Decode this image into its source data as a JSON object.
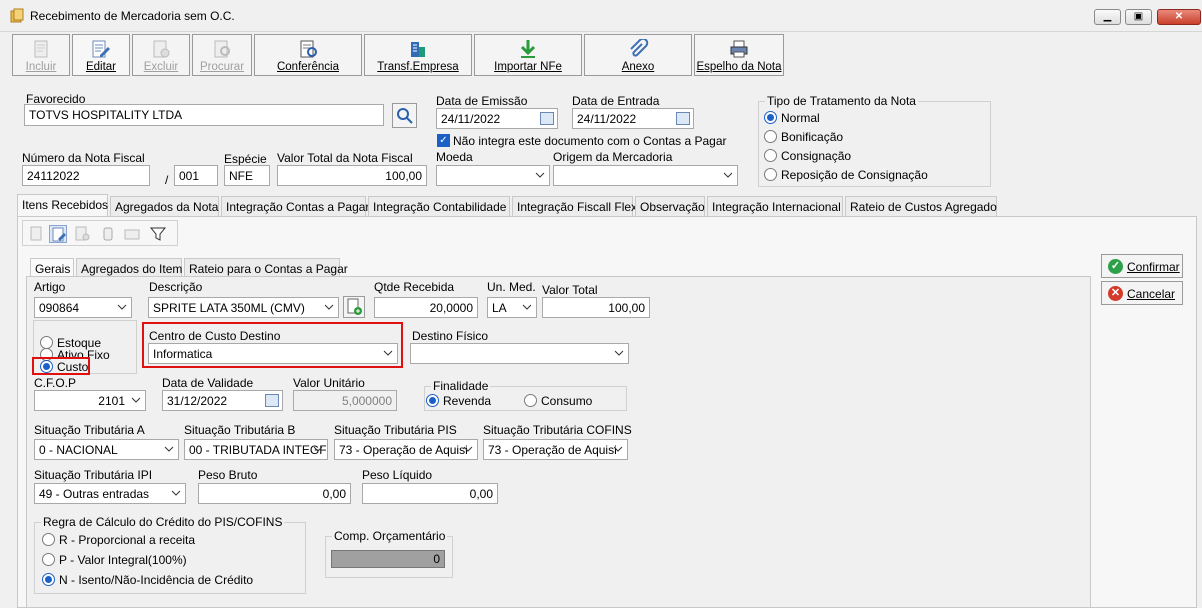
{
  "window": {
    "title": "Recebimento de Mercadoria sem O.C."
  },
  "toolbar": [
    {
      "label": "Incluir",
      "enabled": false
    },
    {
      "label": "Editar",
      "enabled": true
    },
    {
      "label": "Excluir",
      "enabled": false
    },
    {
      "label": "Procurar",
      "enabled": false
    },
    {
      "label": "Conferência",
      "enabled": true
    },
    {
      "label": "Transf.Empresa",
      "enabled": true
    },
    {
      "label": "Importar NFe",
      "enabled": true
    },
    {
      "label": "Anexo",
      "enabled": true
    },
    {
      "label": "Espelho da Nota",
      "enabled": true
    }
  ],
  "header": {
    "favorecido_group": "Favorecido",
    "favorecido_value": "TOTVS HOSPITALITY LTDA",
    "data_emissao_label": "Data de Emissão",
    "data_emissao": "24/11/2022",
    "data_entrada_label": "Data de Entrada",
    "data_entrada": "24/11/2022",
    "nao_integra_label": "Não integra este documento com o Contas a Pagar",
    "nao_integra_checked": true,
    "tipo_tratamento_group": "Tipo de Tratamento da Nota",
    "tipo_tratamento_options": [
      "Normal",
      "Bonificação",
      "Consignação",
      "Reposição de Consignação"
    ],
    "tipo_tratamento_selected": "Normal",
    "numero_nf_label": "Número da Nota Fiscal",
    "numero_nf": "24112022",
    "serie_sep": "/",
    "serie": "001",
    "especie_label": "Espécie",
    "especie": "NFE",
    "valor_total_label": "Valor Total da Nota Fiscal",
    "valor_total": "100,00",
    "moeda_label": "Moeda",
    "moeda": "",
    "origem_label": "Origem da Mercadoria",
    "origem": ""
  },
  "main_tabs": [
    "Itens Recebidos",
    "Agregados da Nota",
    "Integração Contas a Pagar",
    "Integração Contabilidade",
    "Integração Fiscall Flex",
    "Observação",
    "Integração Internacional",
    "Rateio de Custos Agregado"
  ],
  "main_tab_active": "Itens Recebidos",
  "sub_tabs": [
    "Gerais",
    "Agregados do Item",
    "Rateio para o Contas a Pagar"
  ],
  "sub_tab_active": "Gerais",
  "item": {
    "artigo_label": "Artigo",
    "artigo": "090864",
    "descricao_label": "Descrição",
    "descricao": "SPRITE LATA 350ML (CMV)",
    "qtde_label": "Qtde Recebida",
    "qtde": "20,0000",
    "unmed_label": "Un. Med.",
    "unmed": "LA",
    "valor_total_label": "Valor Total",
    "valor_total": "100,00",
    "tipo_options": [
      "Estoque",
      "Ativo Fixo",
      "Custo"
    ],
    "tipo_selected": "Custo",
    "centro_custo_label": "Centro de Custo Destino",
    "centro_custo": "Informatica",
    "destino_fisico_label": "Destino Físico",
    "destino_fisico": "",
    "cfop_label": "C.F.O.P",
    "cfop": "2101",
    "validade_label": "Data de Validade",
    "validade": "31/12/2022",
    "valor_unitario_label": "Valor Unitário",
    "valor_unitario": "5,000000",
    "finalidade_group": "Finalidade",
    "finalidade_options": [
      "Revenda",
      "Consumo"
    ],
    "finalidade_selected": "Revenda",
    "sit_a_label": "Situação Tributária A",
    "sit_a": "0  -  NACIONAL",
    "sit_b_label": "Situação Tributária B",
    "sit_b": "00  -  TRIBUTADA INTEGF",
    "sit_pis_label": "Situação Tributária PIS",
    "sit_pis": "73 - Operação de Aquisi",
    "sit_cofins_label": "Situação Tributária COFINS",
    "sit_cofins": "73 - Operação de Aquisi",
    "sit_ipi_label": "Situação Tributária IPI",
    "sit_ipi": "49 - Outras entradas",
    "peso_bruto_label": "Peso Bruto",
    "peso_bruto": "0,00",
    "peso_liquido_label": "Peso Líquido",
    "peso_liquido": "0,00",
    "regra_group": "Regra de Cálculo do Crédito do PIS/COFINS",
    "regra_options": [
      "R - Proporcional a receita",
      "P - Valor Integral(100%)",
      "N - Isento/Não-Incidência de Crédito"
    ],
    "regra_selected": "N - Isento/Não-Incidência de Crédito",
    "comp_orc_group": "Comp. Orçamentário",
    "comp_orc_value": "0"
  },
  "side_buttons": {
    "confirmar": "Confirmar",
    "cancelar": "Cancelar"
  }
}
